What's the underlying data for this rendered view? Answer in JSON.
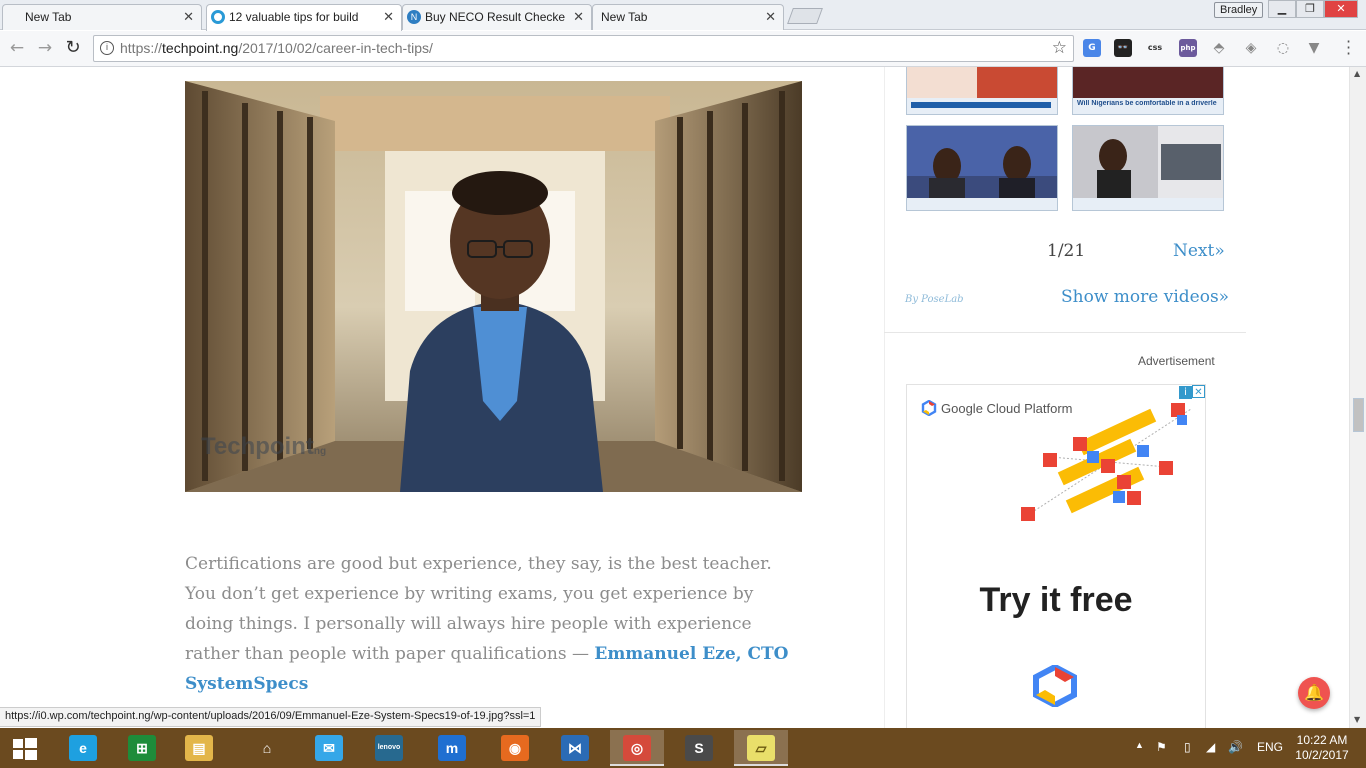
{
  "browser": {
    "tabs": [
      {
        "title": "New Tab",
        "active": false
      },
      {
        "title": "12 valuable tips for build",
        "active": true
      },
      {
        "title": "Buy NECO Result Checke",
        "active": false
      },
      {
        "title": "New Tab",
        "active": false
      }
    ],
    "user": "Bradley",
    "window_buttons": {
      "minimize": "▁",
      "restore": "❐",
      "close": "✕"
    },
    "url": {
      "scheme": "https://",
      "host": "techpoint.ng",
      "path": "/2017/10/02/career-in-tech-tips/"
    },
    "extensions": [
      "G",
      "👓",
      "css",
      "php",
      "⬘",
      "◈",
      "◌",
      "▼"
    ],
    "status_url": "https://i0.wp.com/techpoint.ng/wp-content/uploads/2016/09/Emmanuel-Eze-System-Specs19-of-19.jpg?ssl=1"
  },
  "article": {
    "hero_watermark": "Techpoint",
    "hero_watermark_suffix": "ng",
    "quote": "Certifications are good but experience, they say, is the best teacher. You don’t get experience by writing exams, you get experience by doing things. I personally will always hire people with experience rather than people with paper qualifications — ",
    "author": "Emmanuel Eze, CTO SystemSpecs"
  },
  "sidebar": {
    "thumbnails": [
      {
        "caption": "",
        "bg": "#d44b3c"
      },
      {
        "caption": "Will Nigerians be comfortable in a driverless car?",
        "bg": "#6a2a2a"
      },
      {
        "caption": "",
        "bg": "#3b4b7d"
      },
      {
        "caption": "",
        "bg": "#6c6c74"
      }
    ],
    "pager": {
      "current": "1/21",
      "next": "Next»"
    },
    "byline": "By PoseLab",
    "show_more": "Show more videos»",
    "ad_label": "Advertisement",
    "ad": {
      "brand": "Google Cloud Platform",
      "cta": "Try it free"
    }
  },
  "colors": {
    "link": "#3d8ec9",
    "quote_text": "#8c8c8c",
    "taskbar": "#6b4a1f"
  },
  "taskbar": {
    "apps": [
      {
        "name": "internet-explorer",
        "glyph": "e",
        "bg": "#1ea0e0"
      },
      {
        "name": "store",
        "glyph": "⊞",
        "bg": "#1e8c3a"
      },
      {
        "name": "file-explorer",
        "glyph": "▤",
        "bg": "#e3b64a"
      },
      {
        "name": "home",
        "glyph": "⌂",
        "bg": "transparent"
      },
      {
        "name": "mail",
        "glyph": "✉",
        "bg": "#35a7e8"
      },
      {
        "name": "lenovo",
        "glyph": "lenovo",
        "bg": "#27698f"
      },
      {
        "name": "maxthon",
        "glyph": "m",
        "bg": "#1f6fd1"
      },
      {
        "name": "firefox",
        "glyph": "◉",
        "bg": "#e66a1f"
      },
      {
        "name": "visual-studio",
        "glyph": "⋈",
        "bg": "#2b6bb5"
      },
      {
        "name": "chrome",
        "glyph": "◎",
        "bg": "#d54a3b"
      },
      {
        "name": "sublime",
        "glyph": "S",
        "bg": "#4a4a4a"
      },
      {
        "name": "sticky-notes",
        "glyph": "▱",
        "bg": "#e9df6a"
      }
    ],
    "language": "ENG",
    "time": "10:22 AM",
    "date": "10/2/2017"
  }
}
